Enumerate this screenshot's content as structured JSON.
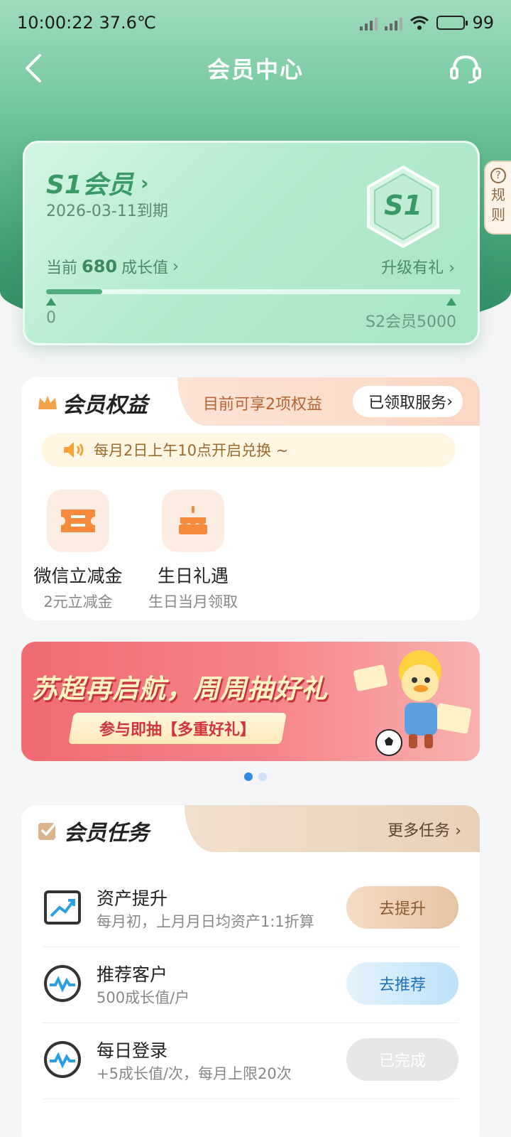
{
  "status_bar": {
    "time": "10:00:22",
    "temperature": "37.6℃",
    "battery": "99"
  },
  "nav": {
    "title": "会员中心"
  },
  "member": {
    "level": "S1会员",
    "expire": "2026-03-11到期",
    "badge": "S1",
    "growth_prefix": "当前",
    "growth_value": "680",
    "growth_suffix": "成长值",
    "upgrade": "升级有礼",
    "progress_start": "0",
    "progress_end": "S2会员5000",
    "progress_fraction": 0.136
  },
  "rules_tab": {
    "q": "?",
    "line1": "规",
    "line2": "则"
  },
  "benefits": {
    "title": "会员权益",
    "count_text": "目前可享2项权益",
    "claimed_button": "已领取服务",
    "notice": "每月2日上午10点开启兑换 ~",
    "items": [
      {
        "name": "微信立减金",
        "sub": "2元立减金",
        "icon": "ticket-icon"
      },
      {
        "name": "生日礼遇",
        "sub": "生日当月领取",
        "icon": "cake-icon"
      }
    ]
  },
  "banner": {
    "title": "苏超再启航，周周抽好礼",
    "subtitle": "参与即抽【多重好礼】",
    "slides": 2,
    "active_slide": 0
  },
  "tasks": {
    "title": "会员任务",
    "more": "更多任务",
    "items": [
      {
        "name": "资产提升",
        "desc": "每月初，上月月日均资产1:1折算",
        "button": "去提升",
        "icon": "trend-chart-icon"
      },
      {
        "name": "推荐客户",
        "desc": "500成长值/户",
        "button": "去推荐",
        "icon": "pulse-icon"
      },
      {
        "name": "每日登录",
        "desc": "+5成长值/次，每月上限20次",
        "button": "已完成",
        "icon": "pulse-icon"
      }
    ]
  },
  "colors": {
    "brand_green": "#3a9a66",
    "accent_orange": "#f08a3c",
    "link_blue": "#1f72b8"
  }
}
